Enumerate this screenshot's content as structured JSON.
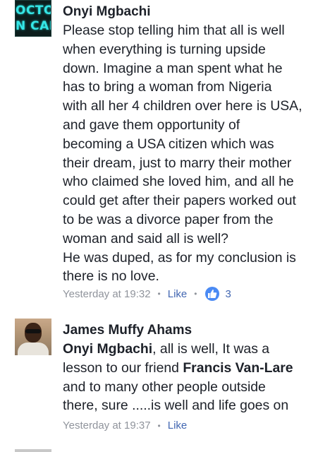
{
  "comments": [
    {
      "author": "Onyi Mgbachi",
      "avatar_text": [
        "OCTO",
        "N CAL"
      ],
      "lines": [
        "Please stop telling him that all is well",
        "when everything is turning upside",
        "down. Imagine a man spent what he",
        "has to bring a woman from Nigeria",
        "with all her 4 children over here is USA,",
        "and gave them opportunity of",
        "becoming a USA citizen which was",
        "their dream, just to marry their mother",
        "who claimed she loved him, and all he",
        "could get after their papers worked out",
        "to be was a divorce paper from the",
        "woman and said all is well?",
        "He was duped, as for my conclusion is",
        "there is no love."
      ],
      "timestamp": "Yesterday at 19:32",
      "like_label": "Like",
      "reaction_count": "3"
    },
    {
      "author": "James Muffy Ahams",
      "line1_mention": "Onyi Mgbachi",
      "line1_rest": ", all is well, It was a",
      "line2_text": "lesson to our friend ",
      "line2_mention": "Francis Van-Lare",
      "lines_rest": [
        "and to many other people outside",
        "there, sure .....is well and life goes on"
      ],
      "timestamp": "Yesterday at 19:37",
      "like_label": "Like"
    }
  ],
  "colors": {
    "text": "#1d2129",
    "meta": "#90949c",
    "link": "#4267b2",
    "like_badge": "#4a8af4"
  }
}
